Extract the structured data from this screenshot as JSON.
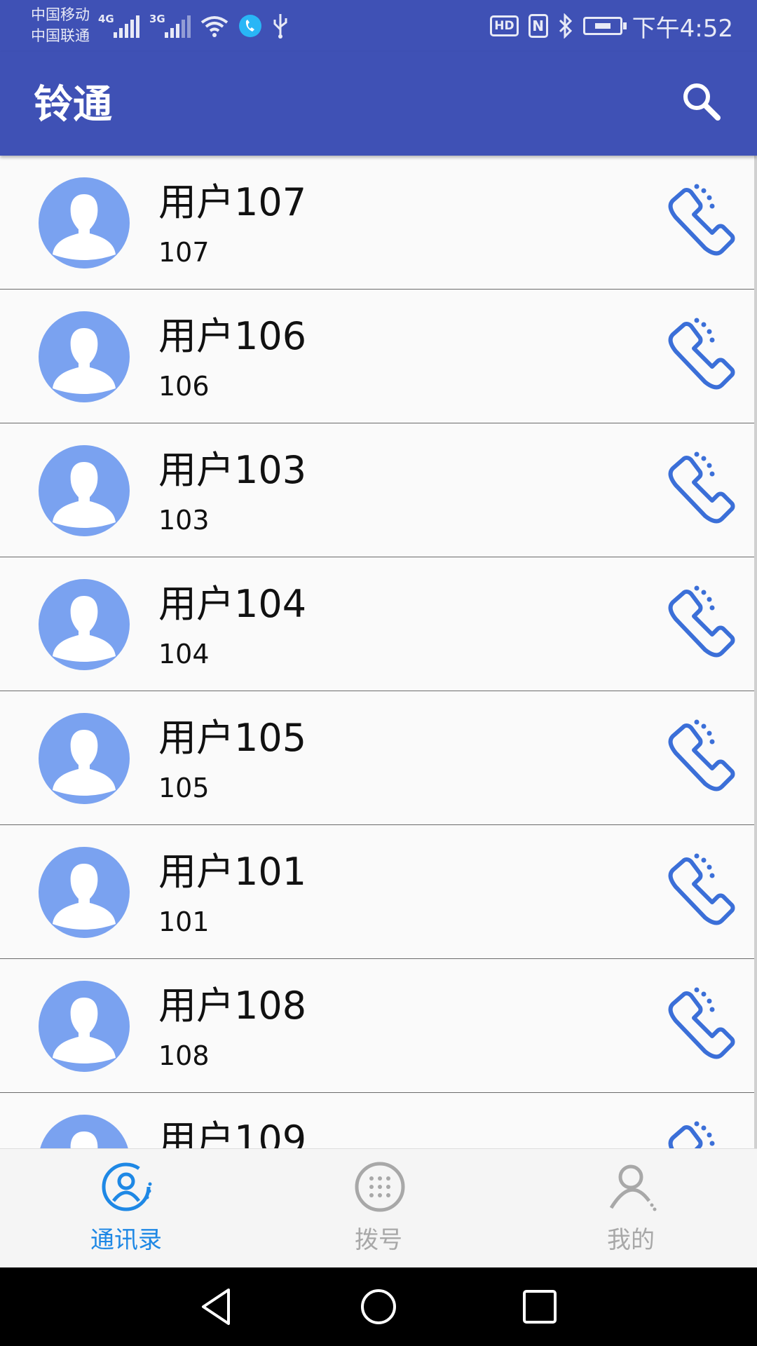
{
  "status_bar": {
    "carrier_1": "中国移动",
    "carrier_2": "中国联通",
    "network_1": "4G",
    "network_2": "3G",
    "hd_label": "HD",
    "nfc_label": "N",
    "time": "下午4:52"
  },
  "app_bar": {
    "title": "铃通",
    "search_icon": "search-icon"
  },
  "contacts": [
    {
      "name": "用户107",
      "number": "107"
    },
    {
      "name": "用户106",
      "number": "106"
    },
    {
      "name": "用户103",
      "number": "103"
    },
    {
      "name": "用户104",
      "number": "104"
    },
    {
      "name": "用户105",
      "number": "105"
    },
    {
      "name": "用户101",
      "number": "101"
    },
    {
      "name": "用户108",
      "number": "108"
    },
    {
      "name": "用户109",
      "number": ""
    }
  ],
  "bottom_nav": {
    "tabs": [
      {
        "label": "通讯录",
        "icon": "contacts-icon",
        "active": true
      },
      {
        "label": "拨号",
        "icon": "dialpad-icon",
        "active": false
      },
      {
        "label": "我的",
        "icon": "profile-icon",
        "active": false
      }
    ]
  },
  "colors": {
    "primary": "#3f51b5",
    "avatar": "#7aa2f0",
    "call_icon": "#3b6fd8",
    "tab_active": "#1e88e5",
    "tab_inactive": "#a8a8a8"
  }
}
